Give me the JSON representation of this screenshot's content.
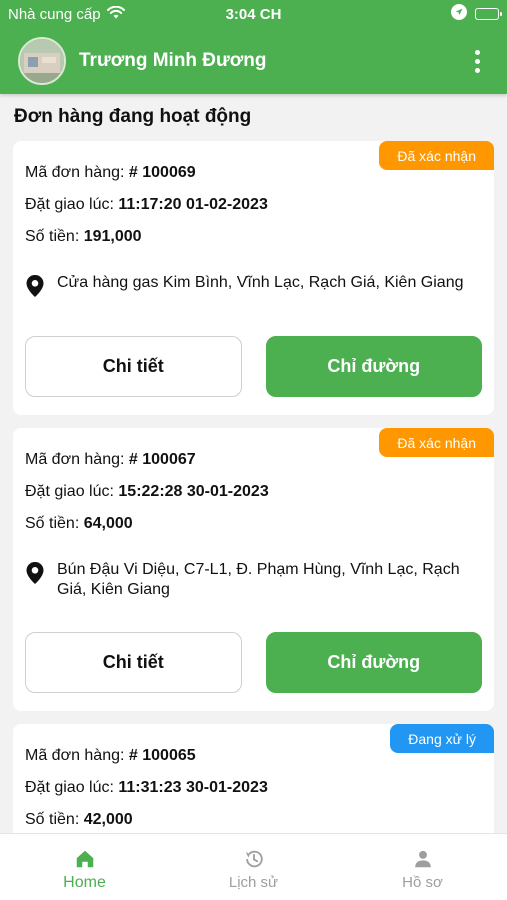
{
  "status": {
    "carrier": "Nhà cung cấp",
    "time": "3:04 CH"
  },
  "header": {
    "user_name": "Trương Minh Đương"
  },
  "section_title": "Đơn hàng đang hoạt động",
  "labels": {
    "order_id": "Mã đơn hàng:",
    "placed_at": "Đặt giao lúc:",
    "amount": "Số tiền:",
    "detail_button": "Chi tiết",
    "directions_button": "Chỉ đường"
  },
  "orders": [
    {
      "id": "# 100069",
      "placed_at": "11:17:20 01-02-2023",
      "amount": "191,000",
      "address": "Cửa hàng gas Kim Bình, Vĩnh Lạc, Rạch Giá, Kiên Giang",
      "status": "Đã xác nhận",
      "status_color": "#ff9800"
    },
    {
      "id": "# 100067",
      "placed_at": "15:22:28 30-01-2023",
      "amount": "64,000",
      "address": "Bún Đậu Vi Diệu, C7-L1, Đ. Phạm Hùng, Vĩnh Lạc, Rạch Giá, Kiên Giang",
      "status": "Đã xác nhận",
      "status_color": "#ff9800"
    },
    {
      "id": "# 100065",
      "placed_at": "11:31:23 30-01-2023",
      "amount": "42,000",
      "address": "",
      "status": "Đang xử lý",
      "status_color": "#2196f3"
    }
  ],
  "nav": [
    {
      "label": "Home",
      "icon": "home-icon",
      "active": true
    },
    {
      "label": "Lịch sử",
      "icon": "history-icon",
      "active": false
    },
    {
      "label": "Hồ sơ",
      "icon": "profile-icon",
      "active": false
    }
  ],
  "colors": {
    "primary": "#4caf50",
    "confirmed": "#ff9800",
    "processing": "#2196f3"
  }
}
